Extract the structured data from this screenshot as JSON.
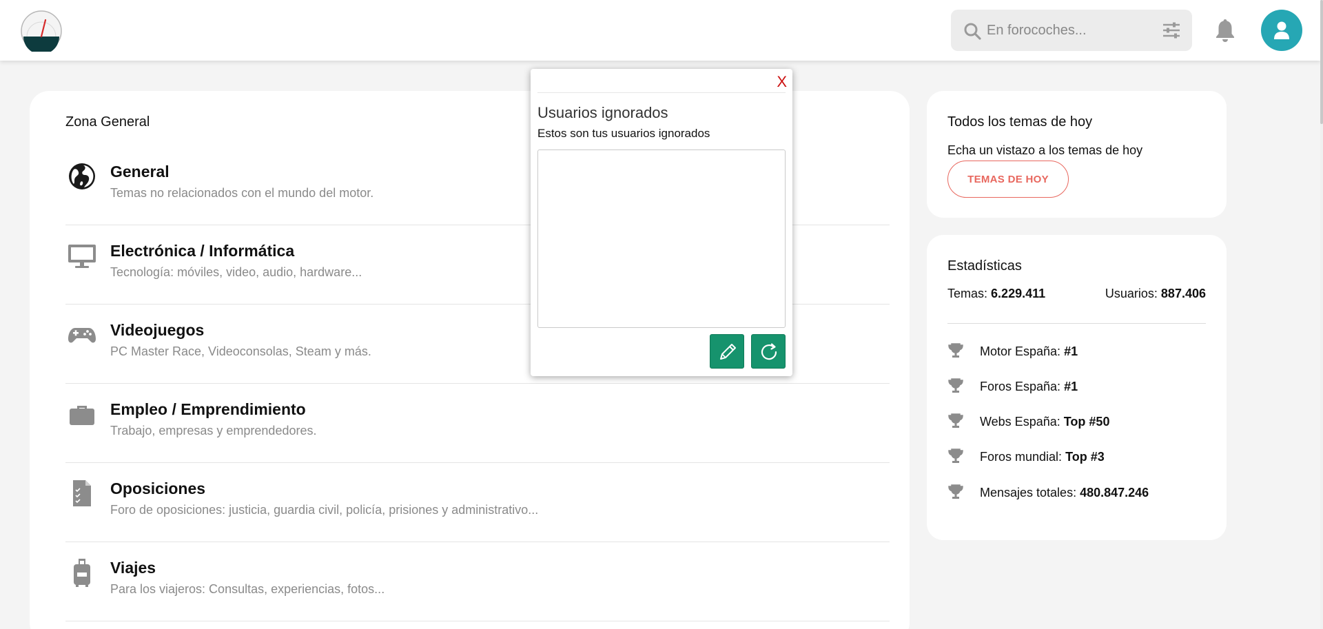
{
  "header": {
    "search_placeholder": "En forocoches..."
  },
  "main": {
    "zone_title": "Zona General",
    "forums": [
      {
        "name": "General",
        "desc": "Temas no relacionados con el mundo del motor.",
        "icon": "globe-icon"
      },
      {
        "name": "Electrónica / Informática",
        "desc": "Tecnología: móviles, video, audio, hardware...",
        "icon": "monitor-icon"
      },
      {
        "name": "Videojuegos",
        "desc": "PC Master Race, Videoconsolas, Steam y más.",
        "icon": "gamepad-icon"
      },
      {
        "name": "Empleo / Emprendimiento",
        "desc": "Trabajo, empresas y emprendedores.",
        "icon": "briefcase-icon"
      },
      {
        "name": "Oposiciones",
        "desc": "Foro de oposiciones: justicia, guardia civil, policía, prisiones y administrativo...",
        "icon": "document-checklist-icon"
      },
      {
        "name": "Viajes",
        "desc": "Para los viajeros: Consultas, experiencias, fotos...",
        "icon": "suitcase-icon"
      }
    ]
  },
  "sidebar": {
    "today": {
      "title": "Todos los temas de hoy",
      "subtitle": "Echa un vistazo a los temas de hoy",
      "button": "TEMAS DE HOY"
    },
    "stats": {
      "title": "Estadísticas",
      "temas_label": "Temas:",
      "temas_value": "6.229.411",
      "usuarios_label": "Usuarios:",
      "usuarios_value": "887.406",
      "ranks": [
        {
          "label": "Motor España:",
          "value": "#1"
        },
        {
          "label": "Foros España:",
          "value": "#1"
        },
        {
          "label": "Webs España:",
          "value": "Top #50"
        },
        {
          "label": "Foros mundial:",
          "value": "Top #3"
        },
        {
          "label": "Mensajes totales:",
          "value": "480.847.246"
        }
      ]
    }
  },
  "modal": {
    "close": "X",
    "title": "Usuarios ignorados",
    "subtitle": "Estos son tus usuarios ignorados",
    "textarea_value": ""
  },
  "colors": {
    "accent_teal": "#26a7b4",
    "button_green": "#16936d",
    "today_button": "#e8675e",
    "close_red": "#cc1111"
  }
}
